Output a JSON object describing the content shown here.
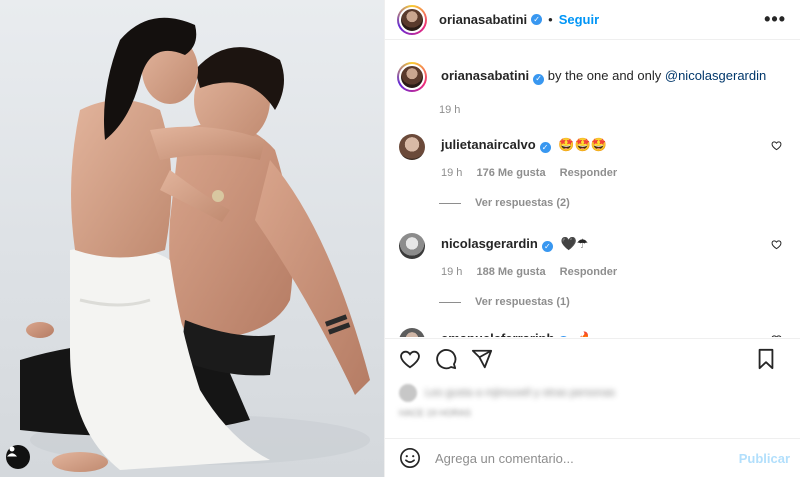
{
  "post": {
    "username": "orianasabatini",
    "follow_label": "Seguir",
    "dot": "•",
    "more": "•••"
  },
  "caption": {
    "username": "orianasabatini",
    "text": "by the one and only",
    "mention": "@nicolasgerardin",
    "time": "19 h"
  },
  "comments": [
    {
      "username": "julietanaircalvo",
      "text": "🤩🤩🤩",
      "time": "19 h",
      "likes": "176 Me gusta",
      "reply": "Responder",
      "view_replies": "Ver respuestas (2)"
    },
    {
      "username": "nicolasgerardin",
      "text": "🖤☂",
      "time": "19 h",
      "likes": "188 Me gusta",
      "reply": "Responder",
      "view_replies": "Ver respuestas (1)"
    },
    {
      "username": "emanueleferrariph",
      "text": "🔥"
    }
  ],
  "likes_blurred": "Les gusta a mjimuvell y otras personas",
  "date_blurred": "HACE 19 HORAS",
  "add_comment": {
    "placeholder": "Agrega un comentario...",
    "publish_label": "Publicar"
  },
  "colors": {
    "accent": "#0095f6",
    "verified": "#3897f0",
    "publish_disabled": "#b2dffc",
    "muted_text": "#8e8e8e"
  },
  "icons": [
    "heart-icon",
    "comment-icon",
    "share-icon",
    "bookmark-icon",
    "emoji-icon",
    "more-icon",
    "user-tag-icon",
    "verified-icon"
  ]
}
